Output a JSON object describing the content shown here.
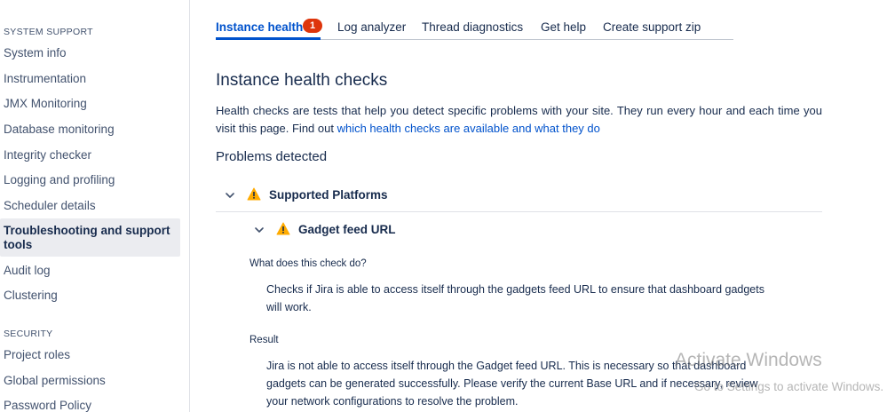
{
  "sidebar": {
    "system_support_title": "SYSTEM SUPPORT",
    "system_items": [
      {
        "label": "System info"
      },
      {
        "label": "Instrumentation"
      },
      {
        "label": "JMX Monitoring"
      },
      {
        "label": "Database monitoring"
      },
      {
        "label": "Integrity checker"
      },
      {
        "label": "Logging and profiling"
      },
      {
        "label": "Scheduler details"
      },
      {
        "label": "Troubleshooting and support tools"
      },
      {
        "label": "Audit log"
      },
      {
        "label": "Clustering"
      }
    ],
    "security_title": "SECURITY",
    "security_items": [
      {
        "label": "Project roles"
      },
      {
        "label": "Global permissions"
      },
      {
        "label": "Password Policy"
      }
    ]
  },
  "tabs": [
    {
      "label": "Instance health",
      "badge": "1"
    },
    {
      "label": "Log analyzer"
    },
    {
      "label": "Thread diagnostics"
    },
    {
      "label": "Get help"
    },
    {
      "label": "Create support zip"
    }
  ],
  "main": {
    "title": "Instance health checks",
    "description": "Health checks are tests that help you detect specific problems with your site. They run every hour and each time you visit this page. Find out ",
    "description_link": "which health checks are available and what they do",
    "problems_title": "Problems detected",
    "group": {
      "label": "Supported Platforms",
      "check": {
        "label": "Gadget feed URL",
        "what_label": "What does this check do?",
        "what_text": "Checks if Jira is able to access itself through the gadgets feed URL to ensure that dashboard gadgets will work.",
        "result_label": "Result",
        "result_text": "Jira is not able to access itself through the Gadget feed URL. This is necessary so that dashboard gadgets can be generated successfully. Please verify the current Base URL and if necessary, review your network configurations to resolve the problem."
      }
    }
  },
  "watermark": {
    "line1": "Activate Windows",
    "line2": "Go to Settings to activate Windows."
  },
  "colors": {
    "accent": "#0052cc",
    "badge": "#de350b",
    "warning": "#ffab00"
  }
}
